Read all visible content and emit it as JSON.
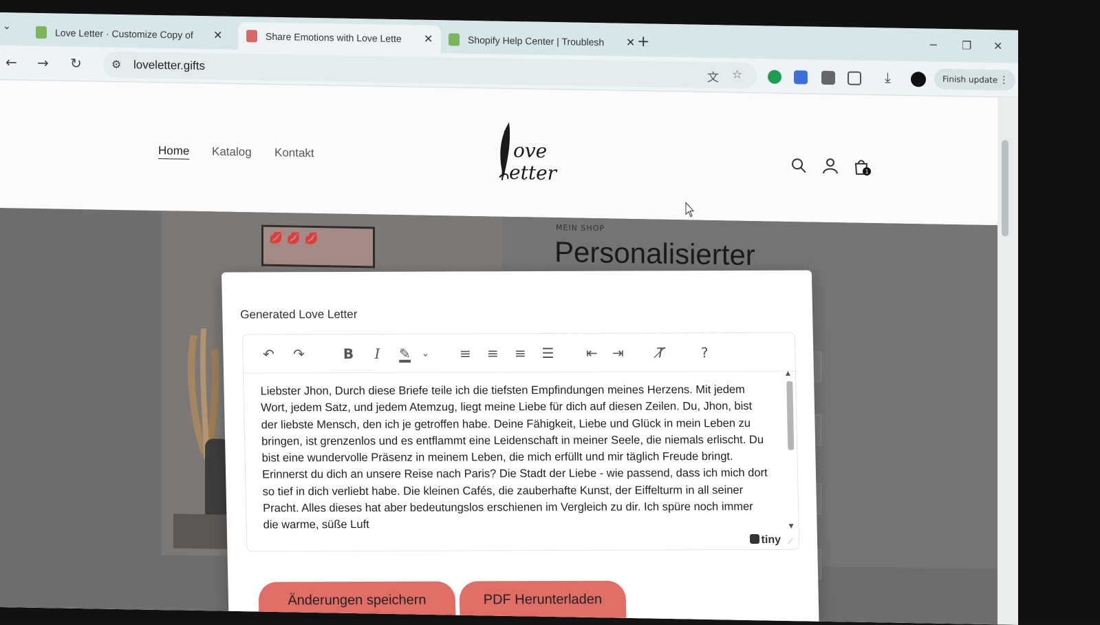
{
  "browser": {
    "tabs": [
      {
        "title": "Love Letter · Customize Copy of",
        "favicon": "shopify-icon",
        "active": false
      },
      {
        "title": "Share Emotions with Love Lette",
        "favicon": "loveletter-icon",
        "active": true
      },
      {
        "title": "Shopify Help Center | Troublesh",
        "favicon": "shopify-icon",
        "active": false
      }
    ],
    "new_tab": "+",
    "url": "loveletter.gifts",
    "finish_update": "Finish update",
    "download_icon": "download-icon"
  },
  "site": {
    "nav": [
      {
        "label": "Home",
        "current": true
      },
      {
        "label": "Katalog",
        "current": false
      },
      {
        "label": "Kontakt",
        "current": false
      }
    ],
    "logo_text": "Love Letter",
    "cart_count": "1",
    "shop_label": "MEIN SHOP",
    "hero_title": "Personalisierter"
  },
  "modal": {
    "title": "Generated Love Letter",
    "toolbar_icons": [
      "undo-icon",
      "redo-icon",
      "bold-icon",
      "italic-icon",
      "highlight-icon",
      "align-left-icon",
      "align-center-icon",
      "align-right-icon",
      "justify-icon",
      "outdent-icon",
      "indent-icon",
      "clear-format-icon",
      "help-icon"
    ],
    "letter_text": "Liebster Jhon, Durch diese Briefe teile ich die tiefsten Empfindungen meines Herzens. Mit jedem Wort, jedem Satz, und jedem Atemzug, liegt meine Liebe für dich auf diesen Zeilen. Du, Jhon, bist der liebste Mensch, den ich je getroffen habe. Deine Fähigkeit, Liebe und Glück in mein Leben zu bringen, ist grenzenlos und es entflammt eine Leidenschaft in meiner Seele, die niemals erlischt. Du bist eine wundervolle Präsenz in meinem Leben, die mich erfüllt und mir täglich Freude bringt. Erinnerst du dich an unsere Reise nach Paris? Die Stadt der Liebe - wie passend, dass ich mich dort so tief in dich verliebt habe. Die kleinen Cafés, die zauberhafte Kunst, der Eiffelturm in all seiner Pracht. Alles dieses hat aber bedeutungslos erschienen im Vergleich zu dir. Ich spüre noch immer die warme, süße Luft",
    "editor_brand": "tiny",
    "save_button": "Änderungen speichern",
    "pdf_button": "PDF Herunterladen",
    "button_color": "#e06d66"
  }
}
